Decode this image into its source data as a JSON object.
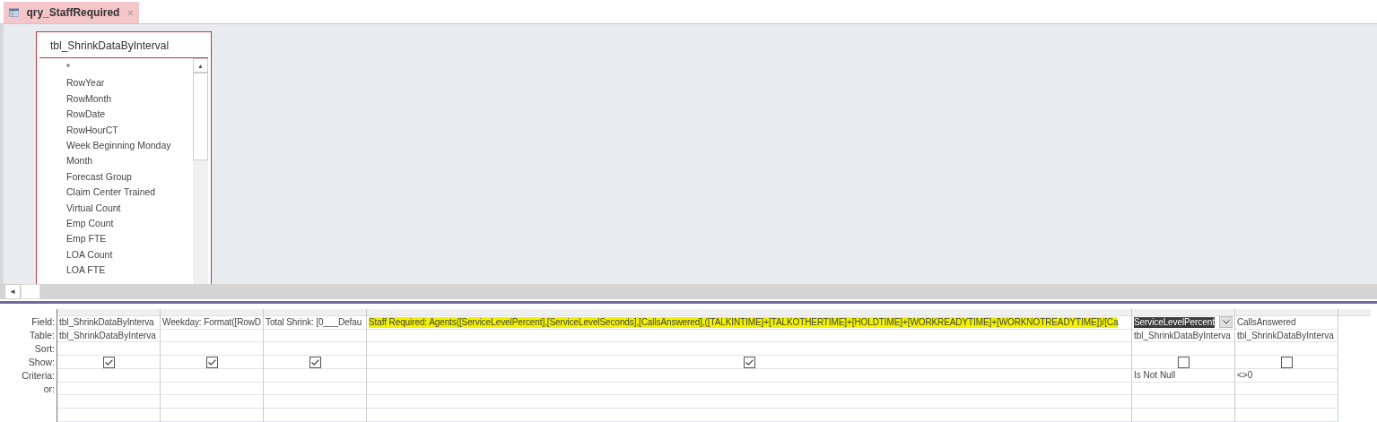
{
  "tab": {
    "title": "qry_StaffRequired",
    "close": "×",
    "selected": true
  },
  "table_box": {
    "title": "tbl_ShrinkDataByInterval",
    "scroll_up": "▲",
    "fields": [
      "*",
      "RowYear",
      "RowMonth",
      "RowDate",
      "RowHourCT",
      "Week Beginning Monday",
      "Month",
      "Forecast Group",
      "Claim Center Trained",
      "Virtual Count",
      "Emp Count",
      "Emp FTE",
      "LOA Count",
      "LOA FTE"
    ]
  },
  "hscroll": {
    "left": "◄"
  },
  "grid": {
    "row_labels": [
      "Field:",
      "Table:",
      "Sort:",
      "Show:",
      "Criteria:",
      "or:"
    ],
    "columns": [
      {
        "field": "tbl_ShrinkDataByInterva",
        "table": "tbl_ShrinkDataByInterva",
        "show": true,
        "highlighted": false,
        "selected": false
      },
      {
        "field": "Weekday: Format([RowD",
        "show": true,
        "highlighted": false,
        "selected": false
      },
      {
        "field": "Total Shrink: [0___Defau",
        "show": true,
        "highlighted": false,
        "selected": false
      },
      {
        "field": "Staff Required: Agents([ServiceLevelPercent],[ServiceLevelSeconds],[CallsAnswered],([TALKINTIME]+[TALKOTHERTIME]+[HOLDTIME]+[WORKREADYTIME]+[WORKNOTREADYTIME])/[Ca",
        "show": true,
        "highlighted": true,
        "selected": false
      },
      {
        "field": "ServiceLevelPercent",
        "table": "tbl_ShrinkDataByInterva",
        "show": false,
        "criteria": "Is Not Null",
        "highlighted": false,
        "selected": true
      },
      {
        "field": "CallsAnswered",
        "table": "tbl_ShrinkDataByInterva",
        "show": false,
        "criteria": "<>0",
        "highlighted": false,
        "selected": false
      }
    ]
  }
}
